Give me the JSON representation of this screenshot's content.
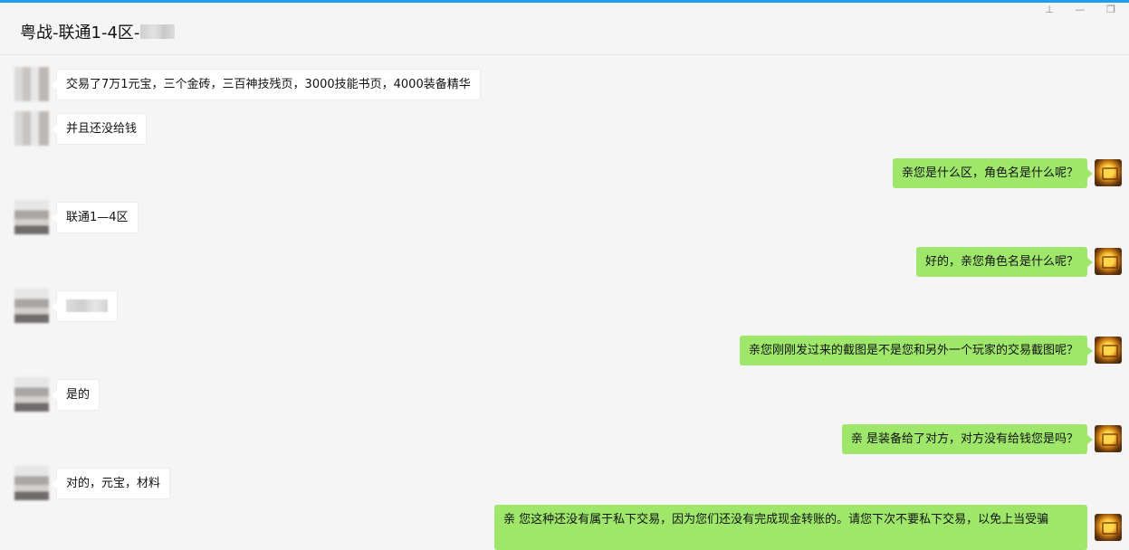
{
  "window": {
    "title": "粤战-联通1-4区-",
    "controls": [
      "pin-icon",
      "minimize-icon",
      "restore-icon"
    ]
  },
  "colors": {
    "accent": "#1ba0e8",
    "outgoing_bubble": "#9fe76b",
    "incoming_bubble": "#ffffff"
  },
  "messages": [
    {
      "side": "in",
      "text": "交易了7万1元宝，三个金砖，三百神技残页，3000技能书页，4000装备精华"
    },
    {
      "side": "in",
      "text": "并且还没给钱"
    },
    {
      "side": "out",
      "text": "亲您是什么区，角色名是什么呢？"
    },
    {
      "side": "in",
      "text": "联通1—4区"
    },
    {
      "side": "out",
      "text": "好的，亲您角色名是什么呢？"
    },
    {
      "side": "in",
      "text": ""
    },
    {
      "side": "out",
      "text": "亲您刚刚发过来的截图是不是您和另外一个玩家的交易截图呢？"
    },
    {
      "side": "in",
      "text": "是的"
    },
    {
      "side": "out",
      "text": "亲 是装备给了对方，对方没有给钱您是吗？"
    },
    {
      "side": "in",
      "text": "对的，元宝，材料"
    },
    {
      "side": "out",
      "text": "亲 您这种还没有属于私下交易，因为您们还没有完成现金转账的。请您下次不要私下交易，以免上当受骗"
    }
  ]
}
